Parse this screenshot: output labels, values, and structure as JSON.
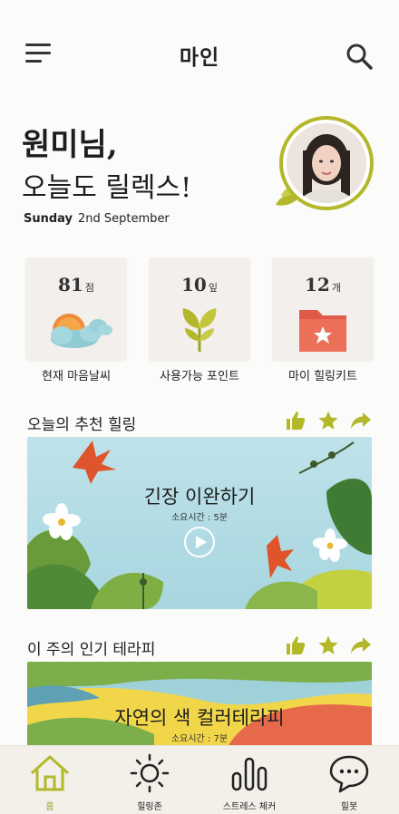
{
  "header": {
    "title": "마인"
  },
  "greeting": {
    "name_line": "원미님,",
    "sub_line": "오늘도 릴렉스!",
    "day": "Sunday",
    "date": "2nd September"
  },
  "stats": [
    {
      "value": "81",
      "unit": "점",
      "label": "현재 마음날씨",
      "icon": "weather-cloud-sun-icon"
    },
    {
      "value": "10",
      "unit": "잎",
      "label": "사용가능 포인트",
      "icon": "leaf-sprout-icon"
    },
    {
      "value": "12",
      "unit": "개",
      "label": "마이 힐링키트",
      "icon": "folder-star-icon"
    }
  ],
  "sections": [
    {
      "title": "오늘의 추천 힐링",
      "banner_title": "긴장 이완하기",
      "banner_sub": "소요시간 : 5분"
    },
    {
      "title": "이 주의 인기 테라피",
      "banner_title": "자연의 색 컬러테라피",
      "banner_sub": "소요시간 : 7분"
    }
  ],
  "tabs": [
    {
      "label": "홈",
      "icon": "home-icon",
      "active": true
    },
    {
      "label": "힐링존",
      "icon": "sun-icon",
      "active": false
    },
    {
      "label": "스트레스 체커",
      "icon": "bars-icon",
      "active": false
    },
    {
      "label": "힐봇",
      "icon": "chat-bubble-icon",
      "active": false
    }
  ],
  "colors": {
    "accent": "#b3b82a",
    "tab_active": "#9ea22a",
    "background": "#fbfbf9",
    "card": "#f3efec",
    "tabbar": "#f2f0e9"
  }
}
